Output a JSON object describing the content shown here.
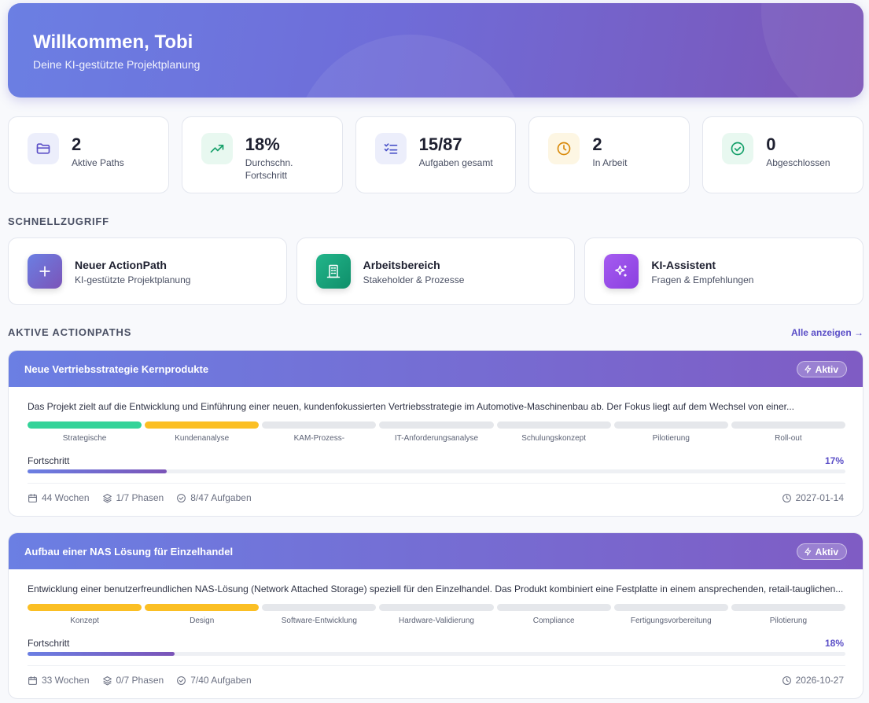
{
  "header": {
    "title": "Willkommen, Tobi",
    "subtitle": "Deine KI-gestützte Projektplanung"
  },
  "stats": [
    {
      "value": "2",
      "label": "Aktive Paths",
      "icon": "folder-icon",
      "color": "#5b4fc7"
    },
    {
      "value": "18%",
      "label": "Durchschn. Fortschritt",
      "icon": "trending-up-icon",
      "color": "#16a06a"
    },
    {
      "value": "15/87",
      "label": "Aufgaben gesamt",
      "icon": "checklist-icon",
      "color": "#4a52c8"
    },
    {
      "value": "2",
      "label": "In Arbeit",
      "icon": "clock-icon",
      "color": "#d98a0b"
    },
    {
      "value": "0",
      "label": "Abgeschlossen",
      "icon": "check-circle-icon",
      "color": "#16a06a"
    }
  ],
  "quick_access": {
    "title": "SCHNELLZUGRIFF",
    "items": [
      {
        "title": "Neuer ActionPath",
        "subtitle": "KI-gestützte Projektplanung",
        "icon": "plus-icon"
      },
      {
        "title": "Arbeitsbereich",
        "subtitle": "Stakeholder & Prozesse",
        "icon": "building-icon"
      },
      {
        "title": "KI-Assistent",
        "subtitle": "Fragen & Empfehlungen",
        "icon": "sparkles-icon"
      }
    ]
  },
  "active_paths": {
    "title": "AKTIVE ACTIONPATHS",
    "view_all": "Alle anzeigen →",
    "progress_label": "Fortschritt",
    "projects": [
      {
        "title": "Neue Vertriebsstrategie Kernprodukte",
        "status": "Aktiv",
        "description": "Das Projekt zielt auf die Entwicklung und Einführung einer neuen, kundenfokussierten Vertriebsstrategie im Automotive-Maschinenbau ab. Der Fokus liegt auf dem Wechsel von einer...",
        "phases": [
          {
            "label": "Strategische",
            "state": "done"
          },
          {
            "label": "Kundenanalyse",
            "state": "active"
          },
          {
            "label": "KAM-Prozess-",
            "state": "open"
          },
          {
            "label": "IT-Anforderungsanalyse",
            "state": "open"
          },
          {
            "label": "Schulungskonzept",
            "state": "open"
          },
          {
            "label": "Pilotierung",
            "state": "open"
          },
          {
            "label": "Roll-out",
            "state": "open"
          }
        ],
        "progress": 17,
        "progress_text": "17%",
        "weeks": "44 Wochen",
        "phases_text": "1/7 Phasen",
        "tasks_text": "8/47 Aufgaben",
        "date": "2027-01-14"
      },
      {
        "title": "Aufbau einer NAS Lösung für Einzelhandel",
        "status": "Aktiv",
        "description": "Entwicklung einer benutzerfreundlichen NAS-Lösung (Network Attached Storage) speziell für den Einzelhandel. Das Produkt kombiniert eine Festplatte in einem ansprechenden, retail-tauglichen...",
        "phases": [
          {
            "label": "Konzept",
            "state": "active"
          },
          {
            "label": "Design",
            "state": "active"
          },
          {
            "label": "Software-Entwicklung",
            "state": "open"
          },
          {
            "label": "Hardware-Validierung",
            "state": "open"
          },
          {
            "label": "Compliance",
            "state": "open"
          },
          {
            "label": "Fertigungsvorbereitung",
            "state": "open"
          },
          {
            "label": "Pilotierung",
            "state": "open"
          }
        ],
        "progress": 18,
        "progress_text": "18%",
        "weeks": "33 Wochen",
        "phases_text": "0/7 Phasen",
        "tasks_text": "7/40 Aufgaben",
        "date": "2026-10-27"
      }
    ]
  },
  "colors": {
    "phase_done": "#34d399",
    "phase_active": "#fbbf24",
    "phase_open": "#e5e7eb",
    "accent": "#5b4fc7"
  }
}
